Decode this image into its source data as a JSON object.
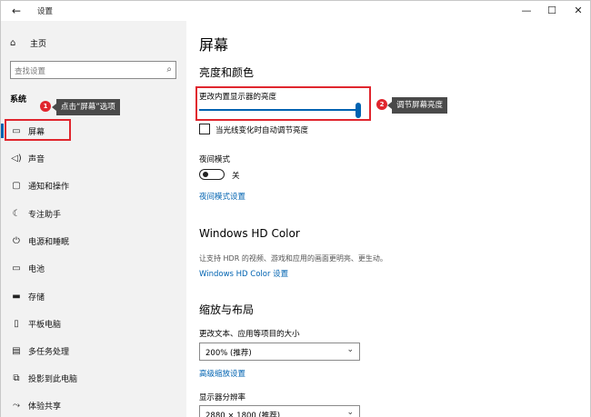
{
  "titlebar": {
    "back_icon": "arrow-left-icon",
    "title": "设置",
    "min": "—",
    "max": "☐",
    "close": "✕"
  },
  "sidebar": {
    "home_label": "主页",
    "search_placeholder": "查找设置",
    "section_title": "系统",
    "items": [
      {
        "label": "屏幕",
        "icon": "monitor-icon"
      },
      {
        "label": "声音",
        "icon": "speaker-icon"
      },
      {
        "label": "通知和操作",
        "icon": "notification-icon"
      },
      {
        "label": "专注助手",
        "icon": "moon-icon"
      },
      {
        "label": "电源和睡眠",
        "icon": "power-icon"
      },
      {
        "label": "电池",
        "icon": "battery-icon"
      },
      {
        "label": "存储",
        "icon": "storage-icon"
      },
      {
        "label": "平板电脑",
        "icon": "tablet-icon"
      },
      {
        "label": "多任务处理",
        "icon": "multitask-icon"
      },
      {
        "label": "投影到此电脑",
        "icon": "project-icon"
      },
      {
        "label": "体验共享",
        "icon": "share-icon"
      }
    ]
  },
  "main": {
    "page_title": "屏幕",
    "brightness_section": "亮度和颜色",
    "brightness_label": "更改内置显示器的亮度",
    "brightness_value": 1.0,
    "auto_brightness_label": "当光线变化时自动调节亮度",
    "night_mode_label": "夜间模式",
    "night_mode_state": "关",
    "night_mode_link": "夜间模式设置",
    "hdr_section": "Windows HD Color",
    "hdr_desc": "让支持 HDR 的视频、游戏和应用的画面更明亮、更生动。",
    "hdr_link": "Windows HD Color 设置",
    "scale_section": "缩放与布局",
    "scale_label": "更改文本、应用等项目的大小",
    "scale_value": "200% (推荐)",
    "scale_link": "高级缩放设置",
    "resolution_label": "显示器分辨率",
    "resolution_value": "2880 × 1800 (推荐)"
  },
  "annotations": {
    "badge1": "1",
    "tip1": "点击“屏幕”选项",
    "badge2": "2",
    "tip2": "调节屏幕亮度",
    "highlight_color": "#e0262e"
  },
  "colors": {
    "accent": "#0063b1",
    "sidebar_bg": "#f2f2f2"
  }
}
